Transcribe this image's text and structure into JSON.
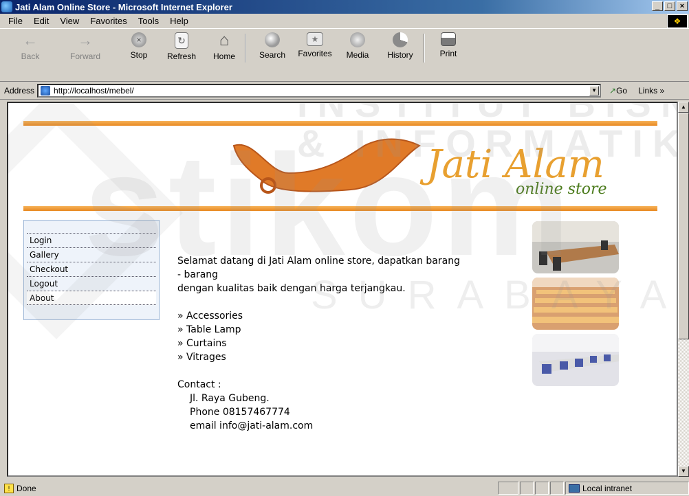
{
  "window": {
    "title": "Jati Alam Online Store - Microsoft Internet Explorer",
    "controls": [
      "_",
      "□",
      "×"
    ]
  },
  "menu": [
    "File",
    "Edit",
    "View",
    "Favorites",
    "Tools",
    "Help"
  ],
  "toolbar": {
    "back": "Back",
    "forward": "Forward",
    "stop": "Stop",
    "refresh": "Refresh",
    "home": "Home",
    "search": "Search",
    "favorites": "Favorites",
    "media": "Media",
    "history": "History",
    "print": "Print"
  },
  "address": {
    "label": "Address",
    "url": "http://localhost/mebel/",
    "go": "Go",
    "links": "Links »"
  },
  "watermark": {
    "institut": "INSTITUT BISNIS",
    "informatika": "& INFORMATIKA",
    "stikom": "stikom",
    "surabaya": "SURABAYA"
  },
  "site": {
    "logo_title": "Jati Alam",
    "logo_tagline": "online store",
    "menu": [
      "Login",
      "Gallery",
      "Checkout",
      "Logout",
      "About"
    ],
    "welcome_line1": "Selamat datang di Jati Alam online store, dapatkan barang",
    "welcome_line2": "- barang",
    "welcome_line3": "dengan kualitas baik dengan harga terjangkau.",
    "products": [
      "» Accessories",
      "» Table Lamp",
      "» Curtains",
      "» Vitrages"
    ],
    "contact_label": "Contact :",
    "contact_address": "Jl. Raya Gubeng.",
    "contact_phone": "Phone 08157467774",
    "contact_email": "email info@jati-alam.com"
  },
  "status": {
    "text": "Done",
    "zone": "Local intranet"
  },
  "colors": {
    "accent_orange": "#e88820",
    "title_blue": "#0a246a"
  }
}
